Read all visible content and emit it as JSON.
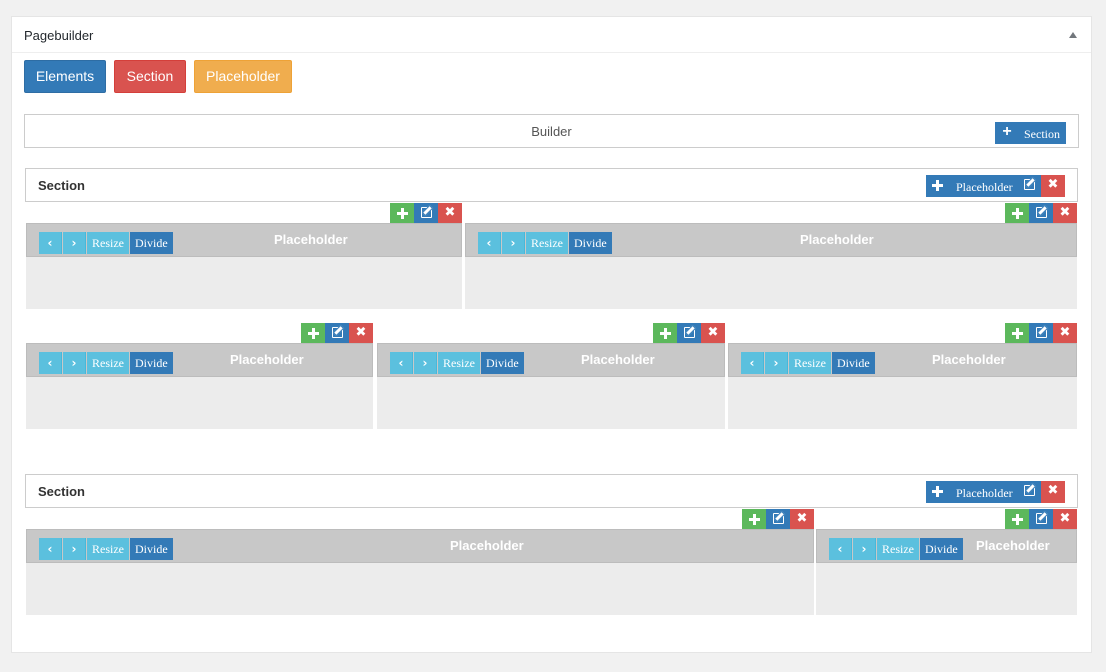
{
  "panel": {
    "title": "Pagebuilder"
  },
  "toolbar": {
    "elements_label": "Elements",
    "section_label": "Section",
    "placeholder_label": "Placeholder"
  },
  "builder": {
    "label": "Builder",
    "add_section_label": "Section"
  },
  "section_common": {
    "title": "Section",
    "add_placeholder_label": "Placeholder"
  },
  "placeholder_common": {
    "title": "Placeholder",
    "resize_label": "Resize",
    "divide_label": "Divide"
  },
  "colors": {
    "primary": "#337ab7",
    "danger": "#d9534f",
    "warning": "#f0ad4e",
    "success": "#5cb85c",
    "info": "#5bc0de"
  }
}
